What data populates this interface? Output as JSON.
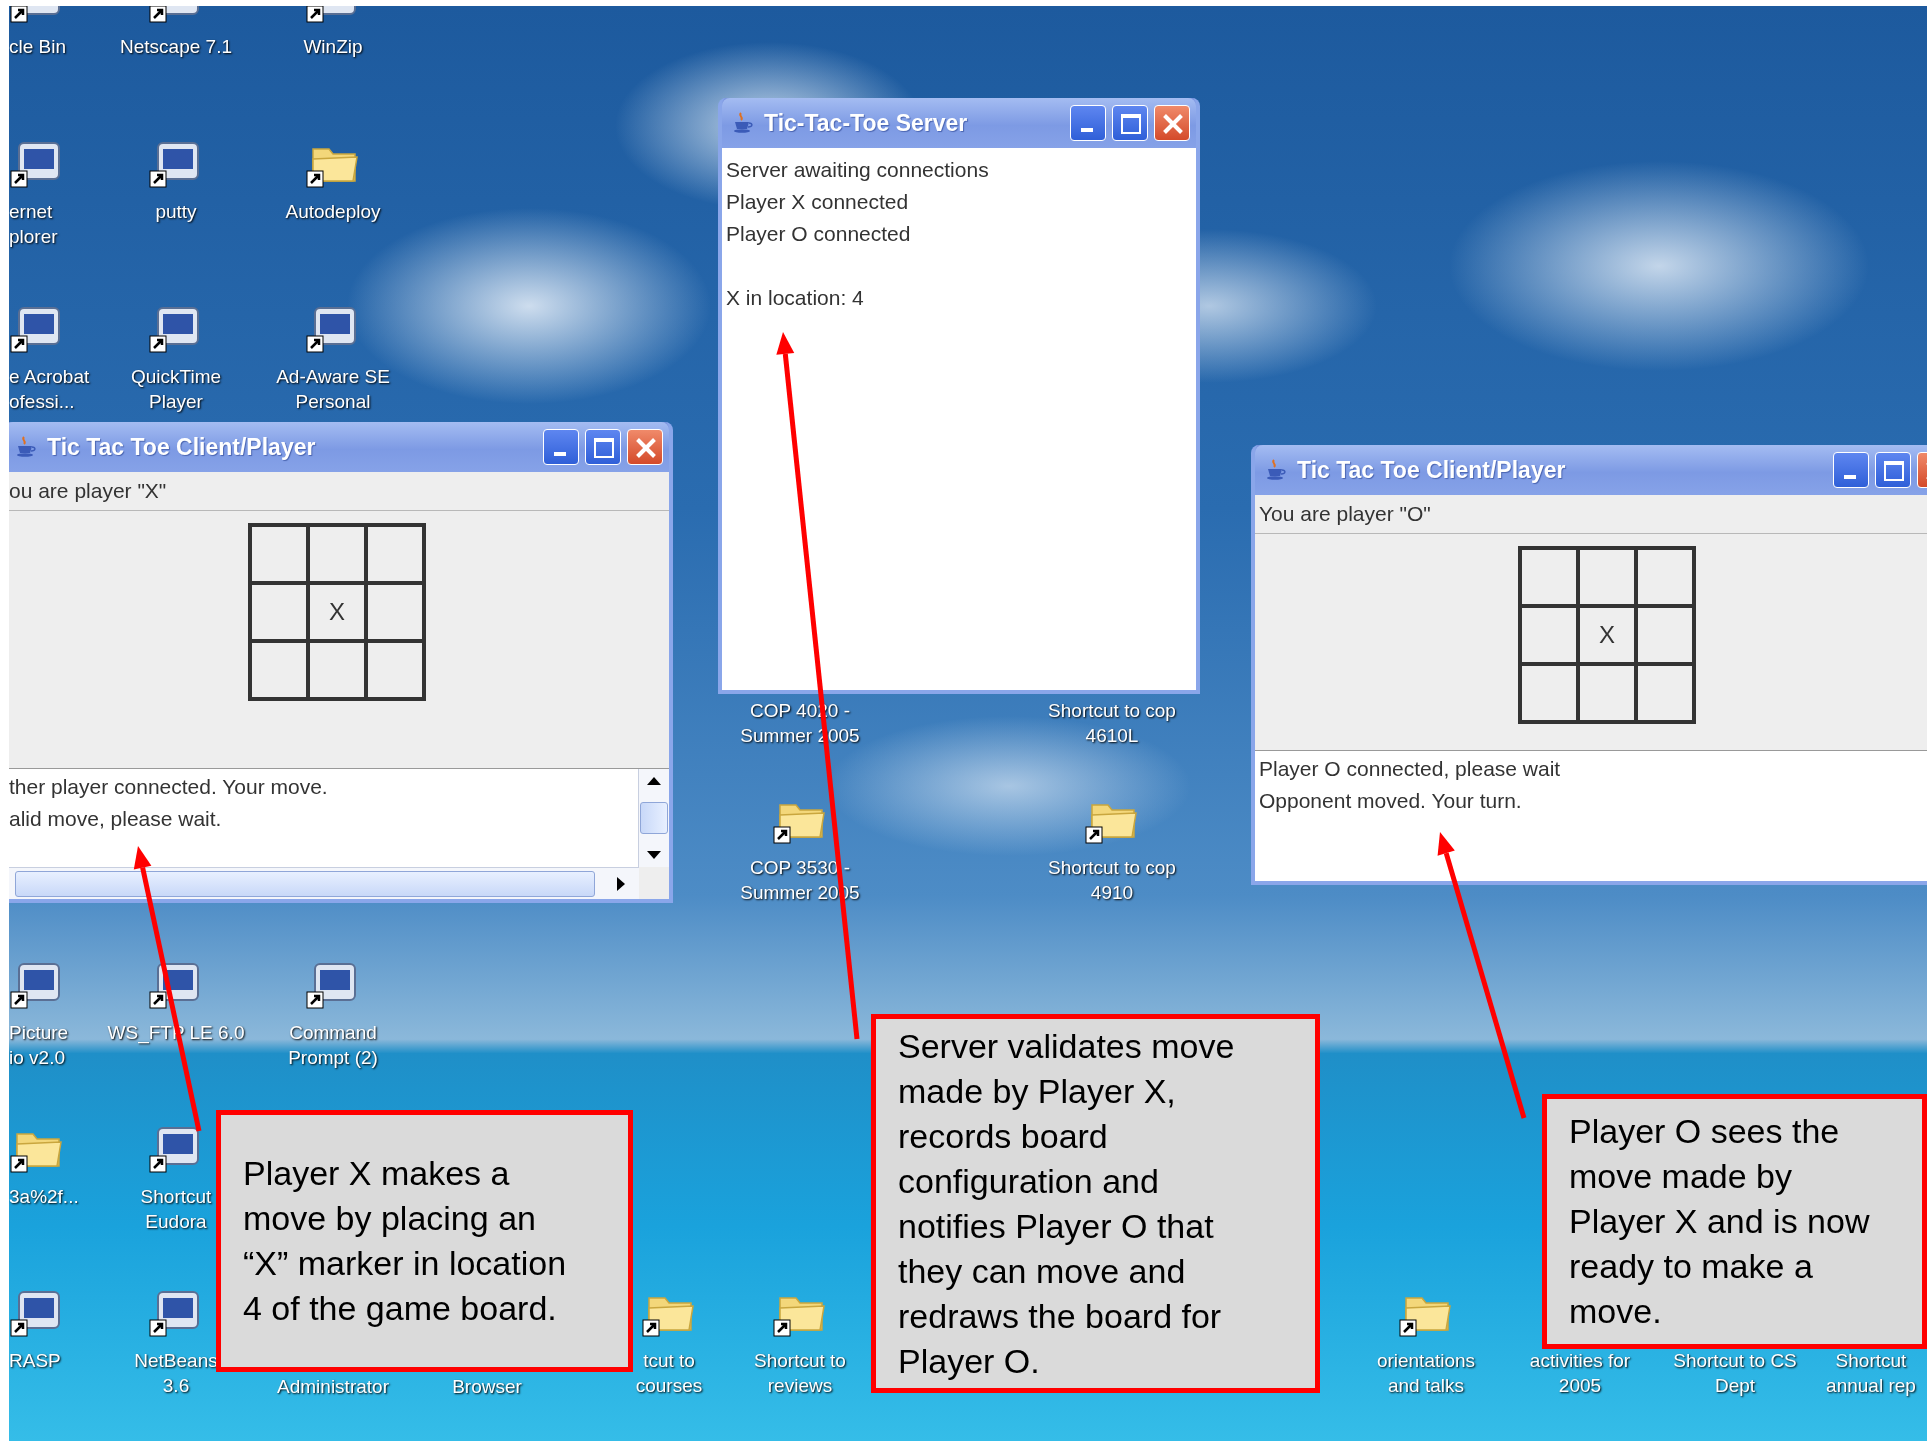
{
  "desktop_icons": [
    {
      "lines": [
        "cle Bin"
      ]
    },
    {
      "lines": [
        "Netscape 7.1"
      ]
    },
    {
      "lines": [
        "WinZip"
      ]
    },
    {
      "lines": [
        "ernet",
        "plorer"
      ]
    },
    {
      "lines": [
        "putty"
      ]
    },
    {
      "lines": [
        "Autodeploy"
      ]
    },
    {
      "lines": [
        "e Acrobat",
        "ofessi..."
      ]
    },
    {
      "lines": [
        "QuickTime",
        "Player"
      ]
    },
    {
      "lines": [
        "Ad-Aware SE",
        "Personal"
      ]
    },
    {
      "lines": [
        "COP 4020 -",
        "Summer 2005"
      ]
    },
    {
      "lines": [
        "Shortcut to cop",
        "4610L"
      ]
    },
    {
      "lines": [
        "COP 3530 -",
        "Summer 2005"
      ]
    },
    {
      "lines": [
        "Shortcut to cop",
        "4910"
      ]
    },
    {
      "lines": [
        "Picture",
        "io v2.0"
      ]
    },
    {
      "lines": [
        "WS_FTP LE 6.0"
      ]
    },
    {
      "lines": [
        "Command",
        "Prompt (2)"
      ]
    },
    {
      "lines": [
        "3a%2f..."
      ]
    },
    {
      "lines": [
        "Shortcut",
        "Eudora"
      ]
    },
    {
      "lines": [
        "RASP"
      ]
    },
    {
      "lines": [
        "NetBeans",
        "3.6"
      ]
    },
    {
      "lines": [
        "Administrator"
      ]
    },
    {
      "lines": [
        "Browser"
      ]
    },
    {
      "lines": [
        "tcut to",
        "courses"
      ]
    },
    {
      "lines": [
        "Shortcut to",
        "reviews"
      ]
    },
    {
      "lines": [
        "orientations",
        "and talks"
      ]
    },
    {
      "lines": [
        "activities for",
        "2005"
      ]
    },
    {
      "lines": [
        "Shortcut to CS",
        "Dept"
      ]
    },
    {
      "lines": [
        "Shortcut",
        "annual rep"
      ]
    }
  ],
  "windows": [
    {
      "kind": "client",
      "title": "Tic Tac Toe Client/Player",
      "player_label": "ou are player \"X\"",
      "board": [
        {
          "kind": "empty"
        },
        {
          "kind": "empty"
        },
        {
          "kind": "empty"
        },
        {
          "kind": "empty"
        },
        {
          "kind": "mark",
          "text": "X"
        },
        {
          "kind": "empty"
        },
        {
          "kind": "empty"
        },
        {
          "kind": "empty"
        },
        {
          "kind": "empty"
        }
      ],
      "log": [
        "ther player connected. Your move.",
        "alid move, please wait."
      ],
      "scrollbars": true
    },
    {
      "kind": "server",
      "title": "Tic-Tac-Toe Server",
      "log": [
        "Server awaiting connections",
        "Player X connected",
        "Player O connected",
        {
          "text": "X in location: 4",
          "blank_before": true
        }
      ]
    },
    {
      "kind": "client",
      "title": "Tic Tac Toe Client/Player",
      "player_label": "You are player \"O\"",
      "board": [
        {
          "kind": "empty"
        },
        {
          "kind": "empty"
        },
        {
          "kind": "empty"
        },
        {
          "kind": "empty"
        },
        {
          "kind": "mark",
          "text": "X"
        },
        {
          "kind": "empty"
        },
        {
          "kind": "empty"
        },
        {
          "kind": "empty"
        },
        {
          "kind": "empty"
        }
      ],
      "log": [
        "Player O connected, please wait",
        "Opponent moved. Your turn."
      ],
      "scrollbars": false
    }
  ],
  "callouts": [
    {
      "lines": [
        "Player X makes a",
        "move by placing an",
        "“X” marker in location",
        "4 of the game board."
      ]
    },
    {
      "lines": [
        "Server validates move",
        "made by Player X,",
        "records board",
        "configuration and",
        "notifies Player O that",
        "they can move and",
        "redraws the board for",
        "Player O."
      ]
    },
    {
      "lines": [
        "Player O sees the",
        "move made by",
        "Player X and is now",
        "ready to make a",
        "move."
      ]
    }
  ]
}
